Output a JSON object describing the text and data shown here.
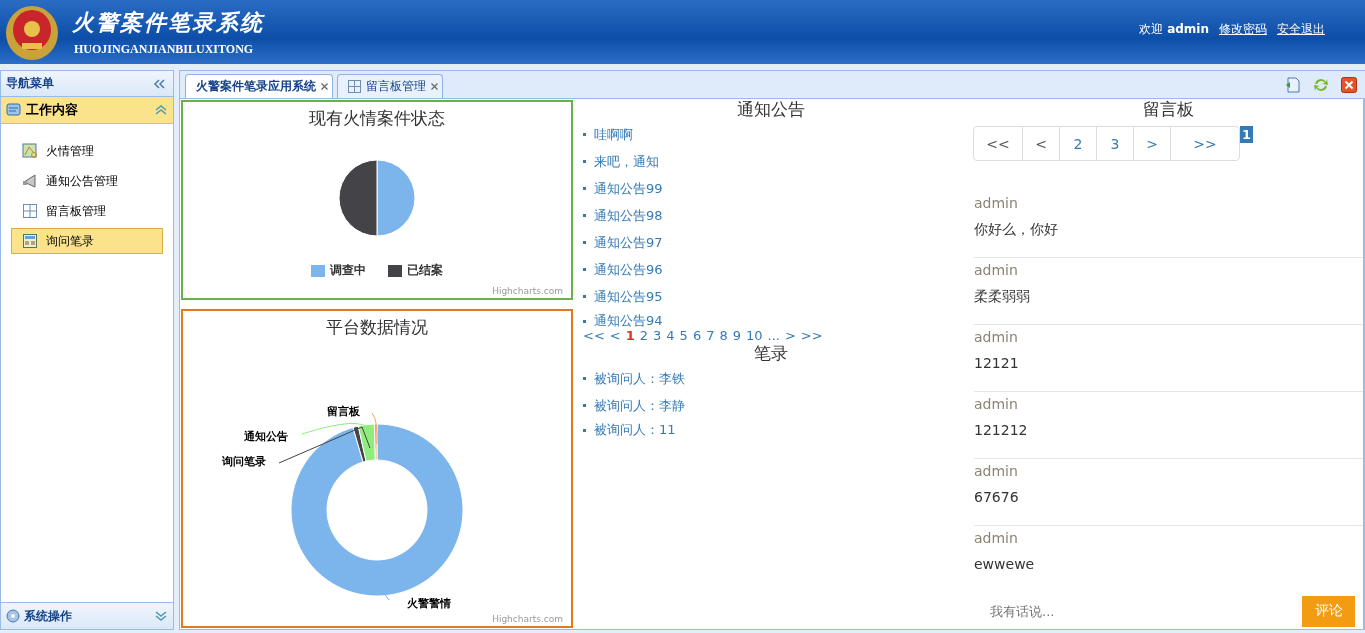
{
  "header": {
    "title": "火警案件笔录系统",
    "subtitle": "HUOJINGANJIANBILUXITONG",
    "welcome": "欢迎",
    "user": "admin",
    "links": [
      "修改密码",
      "安全退出"
    ]
  },
  "sidebar": {
    "title": "导航菜单",
    "section": {
      "label": "工作内容",
      "expanded": true
    },
    "items": [
      {
        "label": "火情管理",
        "selected": false
      },
      {
        "label": "通知公告管理",
        "selected": false
      },
      {
        "label": "留言板管理",
        "selected": false
      },
      {
        "label": "询问笔录",
        "selected": true
      }
    ],
    "bottom_section": {
      "label": "系统操作",
      "expanded": false
    }
  },
  "tabs": [
    {
      "label": "火警案件笔录应用系统",
      "selected": true
    },
    {
      "label": "留言板管理",
      "selected": false
    }
  ],
  "charts": [
    {
      "kind": "pie",
      "title": "现有火情案件状态",
      "legend": [
        {
          "label": "调查中",
          "color": "#7cb5ec"
        },
        {
          "label": "已结案",
          "color": "#434348"
        }
      ],
      "credit": "Highcharts.com"
    },
    {
      "kind": "donut",
      "title": "平台数据情况",
      "labels": [
        {
          "label": "火警警情",
          "color": "#7cb5ec"
        },
        {
          "label": "询问笔录",
          "color": "#434348"
        },
        {
          "label": "通知公告",
          "color": "#90ed7d"
        },
        {
          "label": "留言板",
          "color": "#f7a35c"
        }
      ],
      "credit": "Highcharts.com"
    }
  ],
  "notices": {
    "title": "通知公告",
    "items": [
      "哇啊啊",
      "来吧，通知",
      "通知公告99",
      "通知公告98",
      "通知公告97",
      "通知公告96",
      "通知公告95",
      "通知公告94"
    ],
    "pager": [
      {
        "label": "<<",
        "selected": false
      },
      {
        "label": "<",
        "selected": false
      },
      {
        "label": "1",
        "selected": true
      },
      {
        "label": "2",
        "selected": false
      },
      {
        "label": "3",
        "selected": false
      },
      {
        "label": "4",
        "selected": false
      },
      {
        "label": "5",
        "selected": false
      },
      {
        "label": "6",
        "selected": false
      },
      {
        "label": "7",
        "selected": false
      },
      {
        "label": "8",
        "selected": false
      },
      {
        "label": "9",
        "selected": false
      },
      {
        "label": "10",
        "selected": false
      },
      {
        "label": "...",
        "selected": false
      },
      {
        "label": ">",
        "selected": false
      },
      {
        "label": ">>",
        "selected": false
      }
    ]
  },
  "records": {
    "title": "笔录",
    "items": [
      "被询问人：李铁",
      "被询问人：李静",
      "被询问人：11"
    ]
  },
  "board": {
    "title": "留言板",
    "pager": [
      "<<",
      "<",
      "2",
      "3",
      ">",
      ">>"
    ],
    "current_page": "1",
    "messages": [
      {
        "author": "admin",
        "text": "你好么，你好"
      },
      {
        "author": "admin",
        "text": "柔柔弱弱"
      },
      {
        "author": "admin",
        "text": "12121"
      },
      {
        "author": "admin",
        "text": "121212"
      },
      {
        "author": "admin",
        "text": "67676"
      },
      {
        "author": "admin",
        "text": "ewwewe"
      }
    ],
    "input_placeholder": "我有话说...",
    "submit": "评论"
  }
}
